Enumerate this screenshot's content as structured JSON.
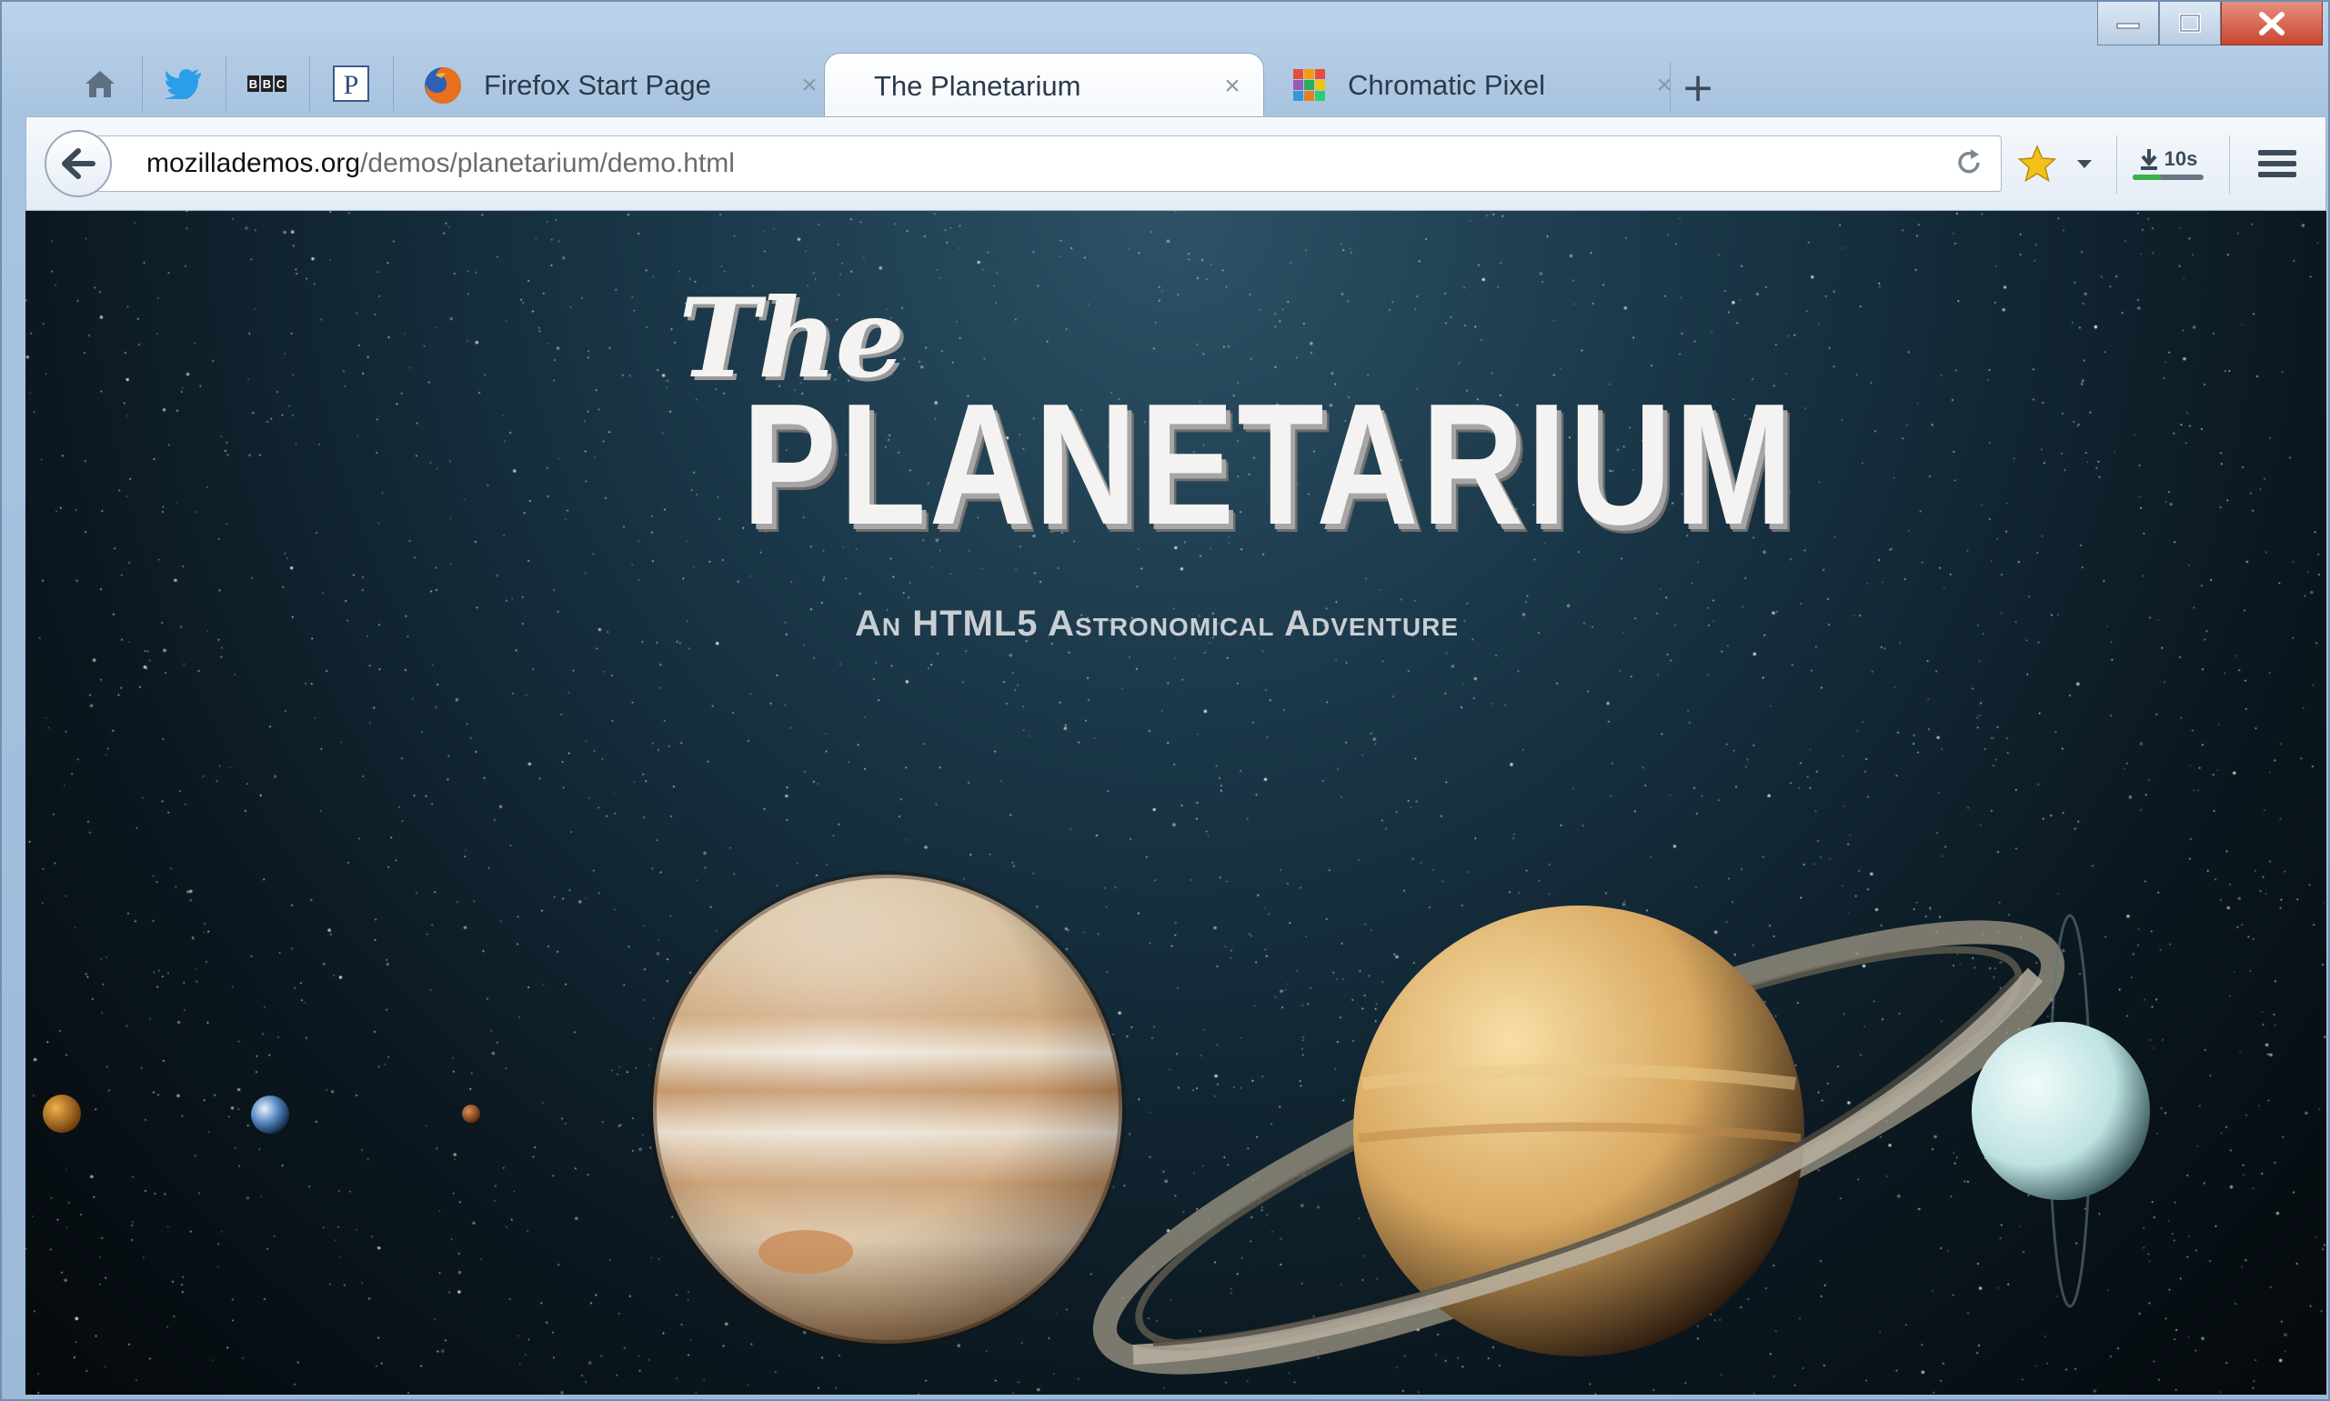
{
  "window": {
    "controls": {
      "minimize": "minimize",
      "maximize": "maximize",
      "close": "close"
    }
  },
  "tabs": {
    "pinned": [
      {
        "name": "home-icon"
      },
      {
        "name": "twitter-icon"
      },
      {
        "name": "bbc-icon",
        "label": "BBC"
      },
      {
        "name": "pinboard-icon",
        "label": "P"
      }
    ],
    "items": [
      {
        "label": "Firefox Start Page",
        "selected": false
      },
      {
        "label": "The Planetarium",
        "selected": true
      },
      {
        "label": "Chromatic Pixel",
        "selected": false
      }
    ],
    "close_glyph": "×",
    "new_tab_glyph": "+"
  },
  "navbar": {
    "url_domain": "mozillademos.org",
    "url_path": "/demos/planetarium/demo.html",
    "download_label": "10s"
  },
  "page": {
    "title_the": "The",
    "title_main": "Planetarium",
    "subtitle": "An HTML5 Astronomical Adventure"
  },
  "colors": {
    "accent_close": "#c8452f",
    "bookmark_star": "#f2c21b",
    "download_progress": "#3cb04a"
  }
}
